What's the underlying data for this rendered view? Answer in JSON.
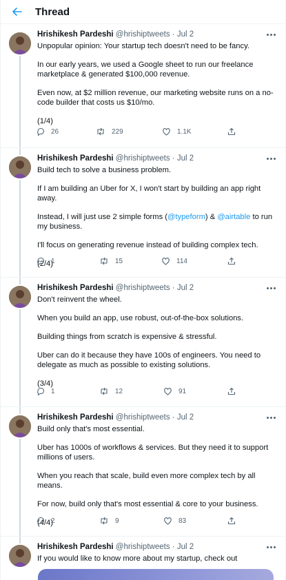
{
  "header": {
    "title": "Thread"
  },
  "tweets": [
    {
      "name": "Hrishikesh Pardeshi",
      "handle": "@hrishiptweets",
      "sep": "·",
      "date": "Jul 2",
      "paras": [
        "Unpopular opinion: Your startup tech doesn't need to be fancy.",
        "In our early years, we used a Google sheet to run our freelance marketplace & generated $100,000 revenue.",
        "Even now, at $2 million revenue, our marketing website runs on a no-code builder that costs us $10/mo.",
        "(1/4)"
      ],
      "replies": "26",
      "retweets": "229",
      "likes": "1.1K"
    },
    {
      "name": "Hrishikesh Pardeshi",
      "handle": "@hrishiptweets",
      "sep": "·",
      "date": "Jul 2",
      "paras": [
        "Build tech to solve a business problem.",
        "If I am building an Uber for X, I won't start by building an app right away.",
        "Instead, I will just use 2 simple forms (",
        "I'll focus on generating revenue instead of building complex tech.",
        "(2/4)"
      ],
      "mention_1": "@typeform",
      "mid_text": ") & ",
      "mention_2": "@airtable",
      "tail_text": " to run my business.",
      "replies": "1",
      "retweets": "15",
      "likes": "114"
    },
    {
      "name": "Hrishikesh Pardeshi",
      "handle": "@hrishiptweets",
      "sep": "·",
      "date": "Jul 2",
      "paras": [
        "Don't reinvent the wheel.",
        "When you build an app, use robust, out-of-the-box solutions.",
        "Building things from scratch is expensive & stressful.",
        "Uber can do it because they have 100s of engineers. You need to delegate as much as possible to existing solutions.",
        "(3/4)"
      ],
      "replies": "1",
      "retweets": "12",
      "likes": "91"
    },
    {
      "name": "Hrishikesh Pardeshi",
      "handle": "@hrishiptweets",
      "sep": "·",
      "date": "Jul 2",
      "paras": [
        "Build only that's most essential.",
        "Uber has 1000s of workflows & services. But they need it to support millions of users.",
        "When you reach that scale, build even more complex tech by all means.",
        "For now, build only that's most essential & core to your business.",
        "(4/4)"
      ],
      "replies": "2",
      "retweets": "9",
      "likes": "83"
    },
    {
      "name": "Hrishikesh Pardeshi",
      "handle": "@hrishiptweets",
      "sep": "·",
      "date": "Jul 2",
      "paras": [
        "If you would like to know more about my startup, check out"
      ]
    }
  ],
  "colors": {
    "accent": "#1d9bf0",
    "muted": "#536471",
    "text": "#0f1419",
    "border": "#eff3f4"
  },
  "icons": {
    "back": "back-arrow-icon",
    "more": "more-options-icon",
    "reply": "reply-icon",
    "retweet": "retweet-icon",
    "like": "heart-icon",
    "share": "share-icon"
  }
}
